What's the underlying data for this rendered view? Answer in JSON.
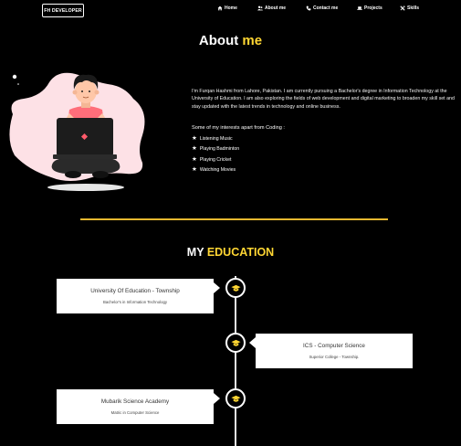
{
  "logo": "FH DEVELOPER",
  "nav": [
    {
      "label": "Home",
      "icon": "home-icon"
    },
    {
      "label": "About me",
      "icon": "users-icon"
    },
    {
      "label": "Contact me",
      "icon": "phone-icon"
    },
    {
      "label": "Projects",
      "icon": "laptop-icon"
    },
    {
      "label": "Skills",
      "icon": "tools-icon"
    }
  ],
  "about": {
    "title_main": "About",
    "title_accent": "me",
    "text": "I'm Furqan Hashmi from Lahore, Pakistan. I am currently pursuing a Bachelor's degree in Information Technology at the University of Education. I am also exploring the fields of web development and digital marketing to broaden my skill set and stay updated with the latest trends in technology and online business.",
    "interests_title": "Some of my interests apart from Coding :",
    "interests": [
      "Listening Music",
      "Playing Badminton",
      "Playing Cricket",
      "Watching Movies"
    ]
  },
  "education": {
    "title_main": "MY",
    "title_accent": "EDUCATION",
    "items": [
      {
        "title": "University Of Education - Township",
        "subtitle": "Bachelor's in Information Technology"
      },
      {
        "title": "ICS - Computer Science",
        "subtitle": "Superior College - Township."
      },
      {
        "title": "Mubarik Science Academy",
        "subtitle": "Matric in Computer Science"
      }
    ]
  },
  "colors": {
    "accent": "#ffd633",
    "background": "#000000",
    "blob": "#fde1e6",
    "divider": "#e6b830"
  }
}
